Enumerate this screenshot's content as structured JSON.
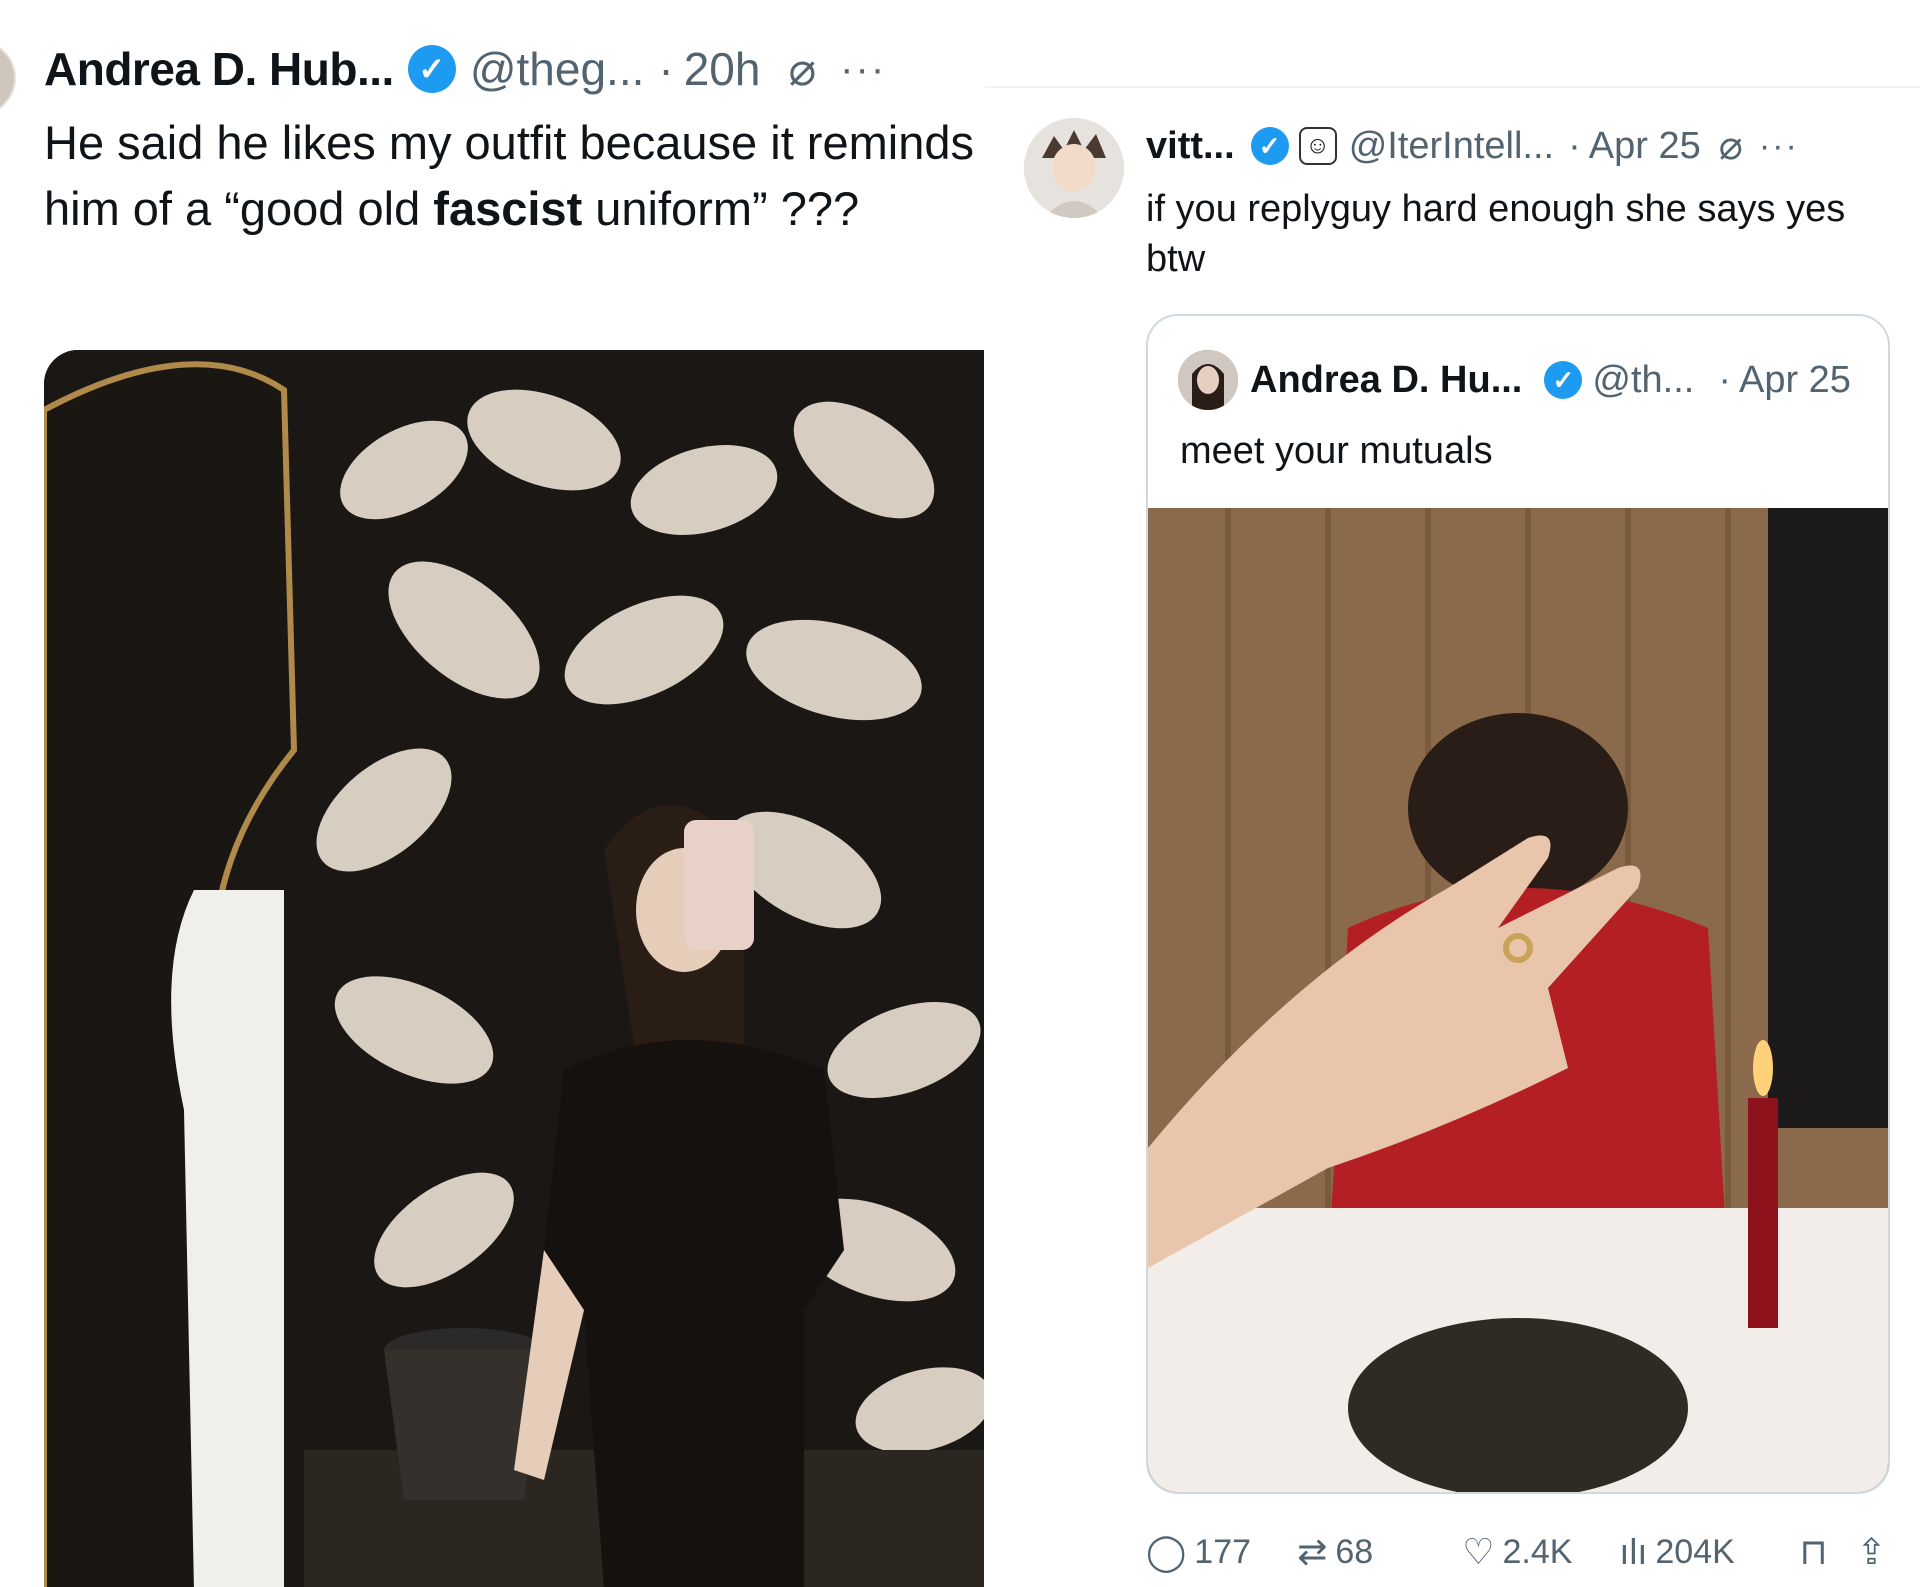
{
  "left_tweet": {
    "name": "Andrea D. Hub...",
    "handle": "@theg...",
    "separator": "·",
    "time": "20h",
    "text_part1": "He said he likes my outfit because it reminds him of a “good old ",
    "text_bold": "fascist",
    "text_part2": " uniform” ???"
  },
  "right_tweet": {
    "name": "vitt...",
    "handle": "@IterIntell...",
    "separator": "·",
    "time": "Apr 25",
    "text": "if you replyguy hard enough she says yes btw",
    "quote": {
      "name": "Andrea D. Hu...",
      "handle": "@th...",
      "separator": "·",
      "time": "Apr 25",
      "text": "meet your mutuals"
    },
    "actions": {
      "replies": "177",
      "reposts": "68",
      "likes": "2.4K",
      "views": "204K"
    }
  },
  "icons": {
    "verified": "verified-check-icon",
    "grok": "grok-slash-icon",
    "more": "more-dots-icon",
    "reply": "reply-bubble-icon",
    "repost": "repost-arrows-icon",
    "like": "heart-icon",
    "views": "views-chart-icon",
    "bookmark": "bookmark-icon",
    "share": "share-icon"
  },
  "colors": {
    "verified_blue": "#1d9bf0",
    "text_primary": "#0f1419",
    "text_secondary": "#536471",
    "card_border": "#cfd9de"
  }
}
